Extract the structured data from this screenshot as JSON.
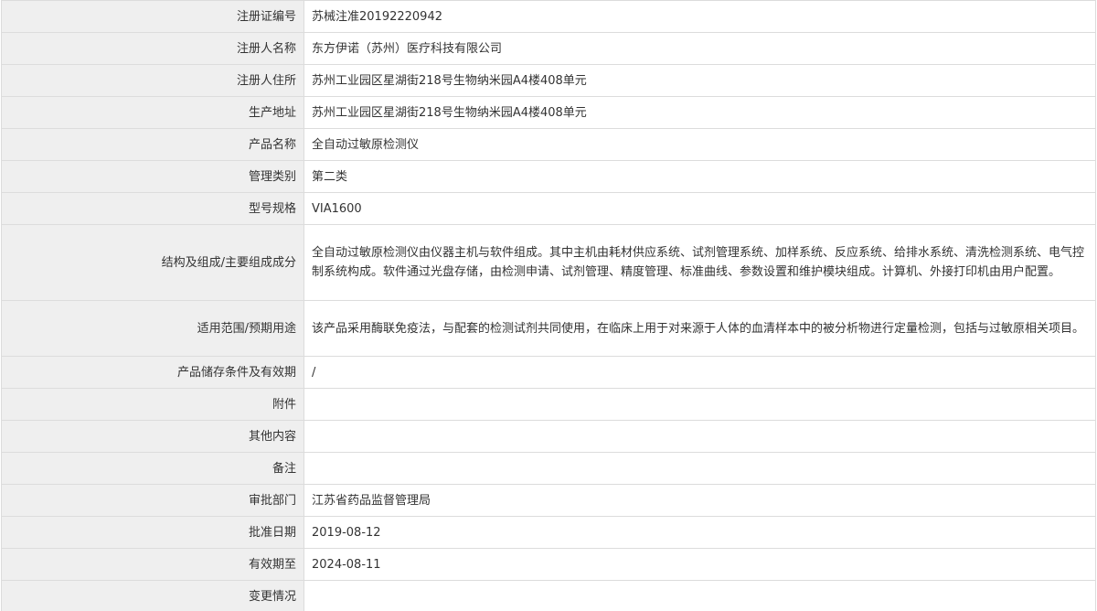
{
  "rows": [
    {
      "label": "注册证编号",
      "value": "苏械注准20192220942"
    },
    {
      "label": "注册人名称",
      "value": "东方伊诺（苏州）医疗科技有限公司"
    },
    {
      "label": "注册人住所",
      "value": "苏州工业园区星湖街218号生物纳米园A4楼408单元"
    },
    {
      "label": "生产地址",
      "value": "苏州工业园区星湖街218号生物纳米园A4楼408单元"
    },
    {
      "label": "产品名称",
      "value": "全自动过敏原检测仪"
    },
    {
      "label": "管理类别",
      "value": "第二类"
    },
    {
      "label": "型号规格",
      "value": "VIA1600"
    },
    {
      "label": "结构及组成/主要组成成分",
      "value": "全自动过敏原检测仪由仪器主机与软件组成。其中主机由耗材供应系统、试剂管理系统、加样系统、反应系统、给排水系统、清洗检测系统、电气控制系统构成。软件通过光盘存储，由检测申请、试剂管理、精度管理、标准曲线、参数设置和维护模块组成。计算机、外接打印机由用户配置。"
    },
    {
      "label": "适用范围/预期用途",
      "value": "该产品采用酶联免疫法，与配套的检测试剂共同使用，在临床上用于对来源于人体的血清样本中的被分析物进行定量检测，包括与过敏原相关项目。"
    },
    {
      "label": "产品储存条件及有效期",
      "value": "/"
    },
    {
      "label": "附件",
      "value": ""
    },
    {
      "label": "其他内容",
      "value": ""
    },
    {
      "label": "备注",
      "value": ""
    },
    {
      "label": "审批部门",
      "value": "江苏省药品监督管理局"
    },
    {
      "label": "批准日期",
      "value": "2019-08-12"
    },
    {
      "label": "有效期至",
      "value": "2024-08-11"
    },
    {
      "label": "变更情况",
      "value": ""
    }
  ]
}
